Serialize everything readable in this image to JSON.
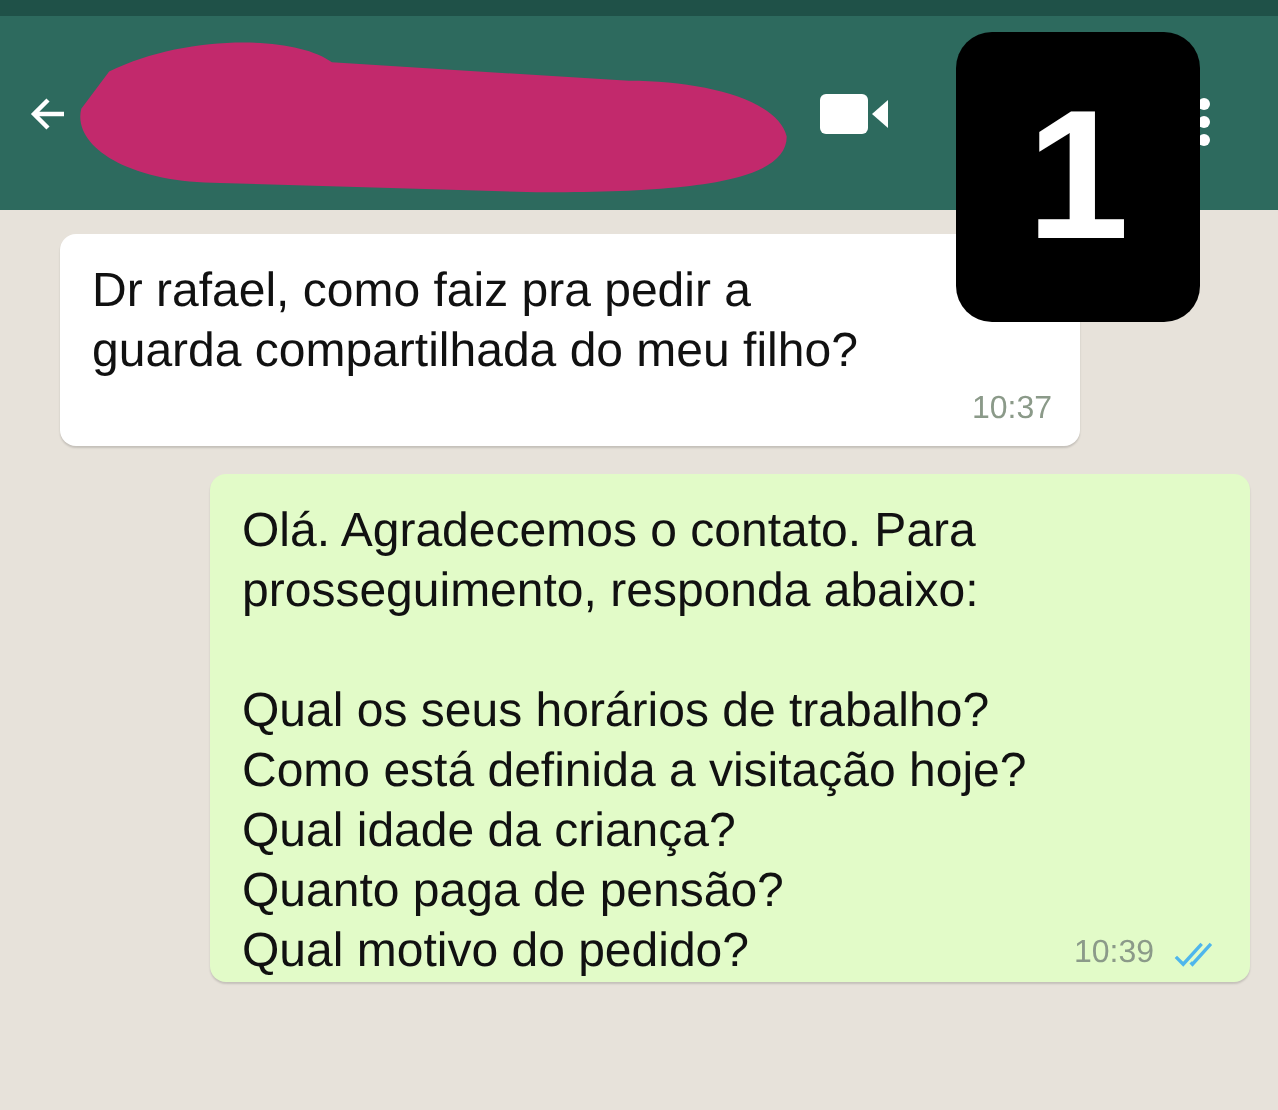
{
  "header": {
    "badge": "1"
  },
  "messages": [
    {
      "kind": "incoming",
      "paragraphs": [
        [
          "Dr rafael, como faiz pra pedir a",
          "guarda compartilhada do meu filho?"
        ]
      ],
      "time": "10:37"
    },
    {
      "kind": "outgoing",
      "paragraphs": [
        [
          "Olá. Agradecemos o contato. Para",
          "prosseguimento, responda abaixo:"
        ],
        [
          "Qual os seus horários de trabalho?",
          "Como está definida a visitação hoje?",
          "Qual idade da criança?",
          "Quanto paga de pensão?",
          "Qual motivo do pedido?"
        ]
      ],
      "time": "10:39",
      "read": true
    }
  ]
}
